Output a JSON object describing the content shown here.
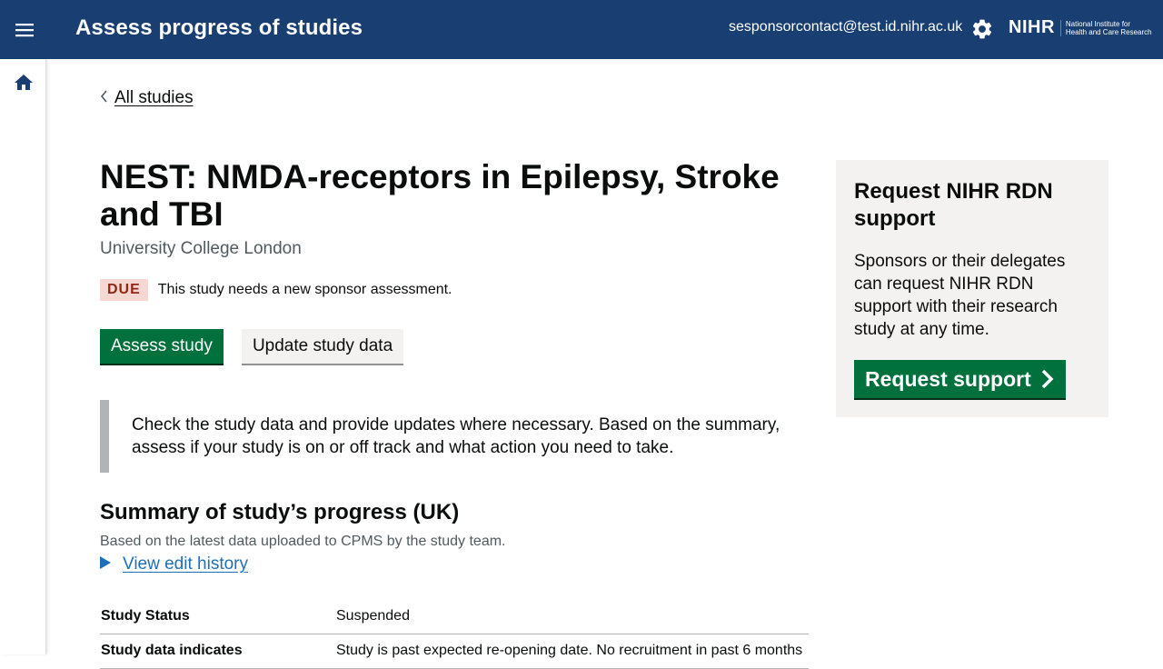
{
  "header": {
    "title": "Assess progress of studies",
    "user_email": "sesponsorcontact@test.id.nihr.ac.uk",
    "logo_text": "NIHR",
    "logo_full_line1": "National Institute for",
    "logo_full_line2": "Health and Care Research",
    "menu_icon": "hamburger-icon",
    "settings_icon": "gear-icon"
  },
  "sidebar": {
    "home_icon": "home-icon"
  },
  "breadcrumb": {
    "back_label": "All studies"
  },
  "study": {
    "title": "NEST: NMDA-receptors in Epilepsy, Stroke and TBI",
    "organisation": "University College London",
    "status_tag": "DUE",
    "status_message": "This study needs a new sponsor assessment."
  },
  "actions": {
    "assess_label": "Assess study",
    "update_label": "Update study data"
  },
  "inset_text": "Check the study data and provide updates where necessary. Based on the summary, assess if your study is on or off track and what action you need to take.",
  "summary": {
    "heading": "Summary of study’s progress (UK)",
    "caption": "Based on the latest data uploaded to CPMS by the study team.",
    "history_link": "View edit history",
    "rows": [
      {
        "label": "Study Status",
        "value": "Suspended"
      },
      {
        "label": "Study data indicates",
        "value": "Study is past expected re-opening date. No recruitment in past 6 months"
      }
    ]
  },
  "side_panel": {
    "title": "Request NIHR RDN support",
    "body": "Sponsors or their delegates can request NIHR RDN support with their research study at any time.",
    "button_label": "Request support"
  },
  "colors": {
    "header_bg": "#193e72",
    "primary_green": "#00703c",
    "link_blue": "#1d70b8",
    "due_bg": "#f6d7d2",
    "due_text": "#942514"
  }
}
